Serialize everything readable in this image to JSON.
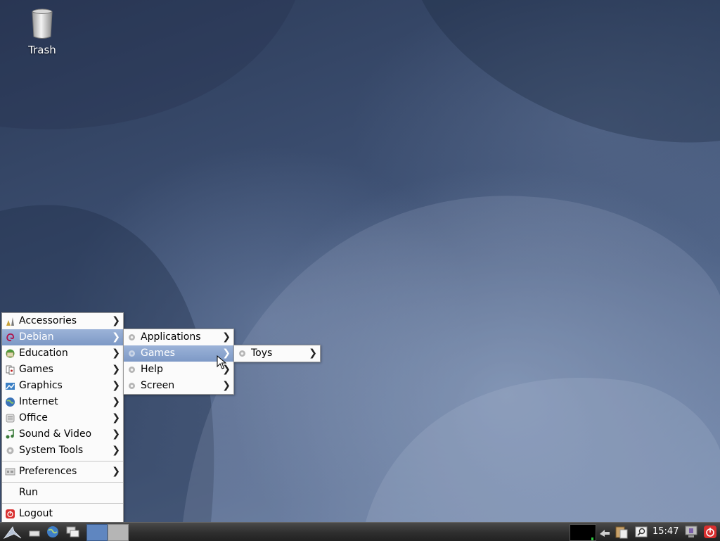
{
  "desktop": {
    "trash_label": "Trash"
  },
  "main_menu": {
    "items": [
      {
        "label": "Accessories",
        "icon": "accessories-icon"
      },
      {
        "label": "Debian",
        "icon": "debian-swirl-icon"
      },
      {
        "label": "Education",
        "icon": "education-icon"
      },
      {
        "label": "Games",
        "icon": "games-icon"
      },
      {
        "label": "Graphics",
        "icon": "graphics-icon"
      },
      {
        "label": "Internet",
        "icon": "internet-globe-icon"
      },
      {
        "label": "Office",
        "icon": "office-icon"
      },
      {
        "label": "Sound & Video",
        "icon": "sound-video-icon"
      },
      {
        "label": "System Tools",
        "icon": "gear-icon"
      },
      {
        "label": "Preferences",
        "icon": "preferences-icon"
      },
      {
        "label": "Run"
      },
      {
        "label": "Logout",
        "icon": "logout-icon"
      }
    ],
    "active": "Debian"
  },
  "debian_submenu": {
    "items": [
      {
        "label": "Applications"
      },
      {
        "label": "Games"
      },
      {
        "label": "Help"
      },
      {
        "label": "Screen"
      }
    ],
    "active": "Games"
  },
  "games_submenu": {
    "items": [
      {
        "label": "Toys"
      }
    ]
  },
  "panel": {
    "clock": "15:47"
  },
  "colors": {
    "menu_highlight": "#7d99c6",
    "panel_bg": "#2e2e2e",
    "logout_red": "#d93030"
  }
}
